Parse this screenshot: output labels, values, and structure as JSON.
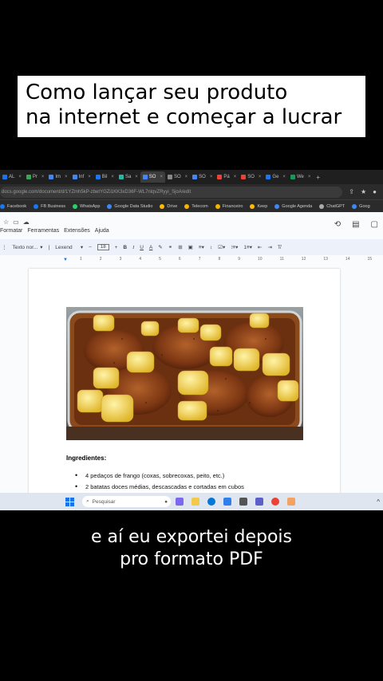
{
  "title_overlay": {
    "line1": "Como lançar seu produto",
    "line2": "na internet e começar a lucrar"
  },
  "caption": {
    "line1": "e aí eu exportei depois",
    "line2": "pro formato PDF"
  },
  "browser": {
    "tabs": [
      {
        "label": "AL",
        "color": "#1a73e8"
      },
      {
        "label": "Pr",
        "color": "#34a853"
      },
      {
        "label": "Im",
        "color": "#4285f4"
      },
      {
        "label": "Inf",
        "color": "#4285f4"
      },
      {
        "label": "Bil",
        "color": "#1877f2"
      },
      {
        "label": "Sa",
        "color": "#2ab5a3"
      },
      {
        "label": "SO",
        "color": "#4285f4",
        "active": true
      },
      {
        "label": "SO",
        "color": "#888888"
      },
      {
        "label": "SO",
        "color": "#4285f4"
      },
      {
        "label": "Pá",
        "color": "#ea4335"
      },
      {
        "label": "SO",
        "color": "#ea4335"
      },
      {
        "label": "Ge",
        "color": "#1877f2"
      },
      {
        "label": "We",
        "color": "#0f9d58"
      }
    ],
    "url": "docs.google.com/document/d/1YZmh5kP-zbetYGZi1KK3xD36F-WL7nlqvZRyyi_SjoA/edit",
    "bookmarks": [
      {
        "label": "Facebook",
        "color": "#1877f2"
      },
      {
        "label": "FB Business",
        "color": "#1877f2"
      },
      {
        "label": "WhatsApp",
        "color": "#25d366"
      },
      {
        "label": "Google Data Studio",
        "color": "#4285f4"
      },
      {
        "label": "Drive",
        "color": "#fbbc05"
      },
      {
        "label": "Telecom",
        "color": "#f4b400"
      },
      {
        "label": "Financeiro",
        "color": "#f4b400"
      },
      {
        "label": "Keep",
        "color": "#fbbc05"
      },
      {
        "label": "Google Agenda",
        "color": "#4285f4"
      },
      {
        "label": "ChatGPT",
        "color": "#aaaaaa"
      },
      {
        "label": "Goog",
        "color": "#4285f4"
      }
    ]
  },
  "docs": {
    "menu": [
      "Formatar",
      "Ferramentas",
      "Extensões",
      "Ajuda"
    ],
    "toolbar": {
      "style": "Texto nor...",
      "font": "Lexend",
      "font_size": "18",
      "bold": "B",
      "italic": "I",
      "underline": "U",
      "color": "A"
    },
    "ruler_numbers": [
      "1",
      "2",
      "3",
      "4",
      "5",
      "6",
      "7",
      "8",
      "9",
      "10",
      "11",
      "12",
      "13",
      "14",
      "15",
      "16",
      "17",
      "18"
    ],
    "content": {
      "heading": "Ingredientes:",
      "items": [
        "4 pedaços de frango (coxas, sobrecoxas, peito, etc.)",
        "2 batatas doces médias, descascadas e cortadas em cubos"
      ]
    }
  },
  "taskbar": {
    "search_placeholder": "Pesquisar"
  }
}
